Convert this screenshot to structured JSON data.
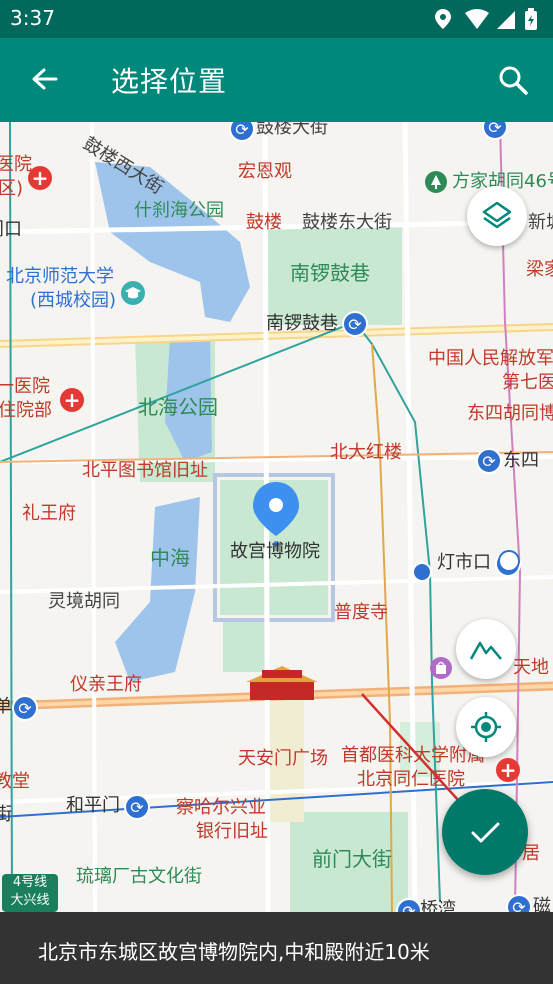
{
  "status": {
    "time": "3:37"
  },
  "appbar": {
    "title": "选择位置"
  },
  "map": {
    "labels": {
      "gulou_west": "鼓楼西大街",
      "gulou_dajie": "鼓楼大街",
      "yuanxi_hosp": "医院",
      "qu": "区)",
      "kou": "门口",
      "hongen": "宏恩观",
      "fangjia": "方家胡同46号",
      "shichahai": "什刹海公园",
      "gulou": "鼓楼",
      "gulou_east": "鼓楼东大街",
      "xincheng": "新城",
      "bnu": "北京师范大学",
      "bnu_campus": "(西城校园)",
      "nanluo_green": "南锣鼓巷",
      "liangjia": "梁家",
      "nanluo_metro": "南锣鼓巷",
      "pla": "中国人民解放军",
      "diqi": "第七医",
      "yiyuan1": "一医院",
      "zhuyuan": "住院部",
      "beihai": "北海公园",
      "dongsi_hutong": "东四胡同博",
      "beida_honglou": "北大红楼",
      "dongsi": "东四",
      "beiping_lib": "北平图书馆旧址",
      "liwangfu": "礼王府",
      "gugong": "故宫博物院",
      "zhonghai": "中海",
      "dengshikou": "灯市口",
      "lingjing": "灵境胡同",
      "pudu": "普度寺",
      "tiandi": "天地",
      "yiqin": "仪亲王府",
      "dan": "单",
      "tiananmen_sq": "天安门广场",
      "shoudu": "首都医科大学附属",
      "tongren": "北京同仁医院",
      "jiaotang": "教堂",
      "jie": "街",
      "hepingmen": "和平门",
      "chahar1": "察哈尔兴业",
      "chahar2": "银行旧址",
      "qianmen": "前门大街",
      "liulichang": "琉璃厂古文化街",
      "qiaowan": "桥湾",
      "ju": "居",
      "ci": "磁",
      "gu_short": "故",
      "line4a": "4号线",
      "line4b": "大兴线"
    }
  },
  "bottom": {
    "address": "北京市东城区故宫博物院内,中和殿附近10米"
  }
}
